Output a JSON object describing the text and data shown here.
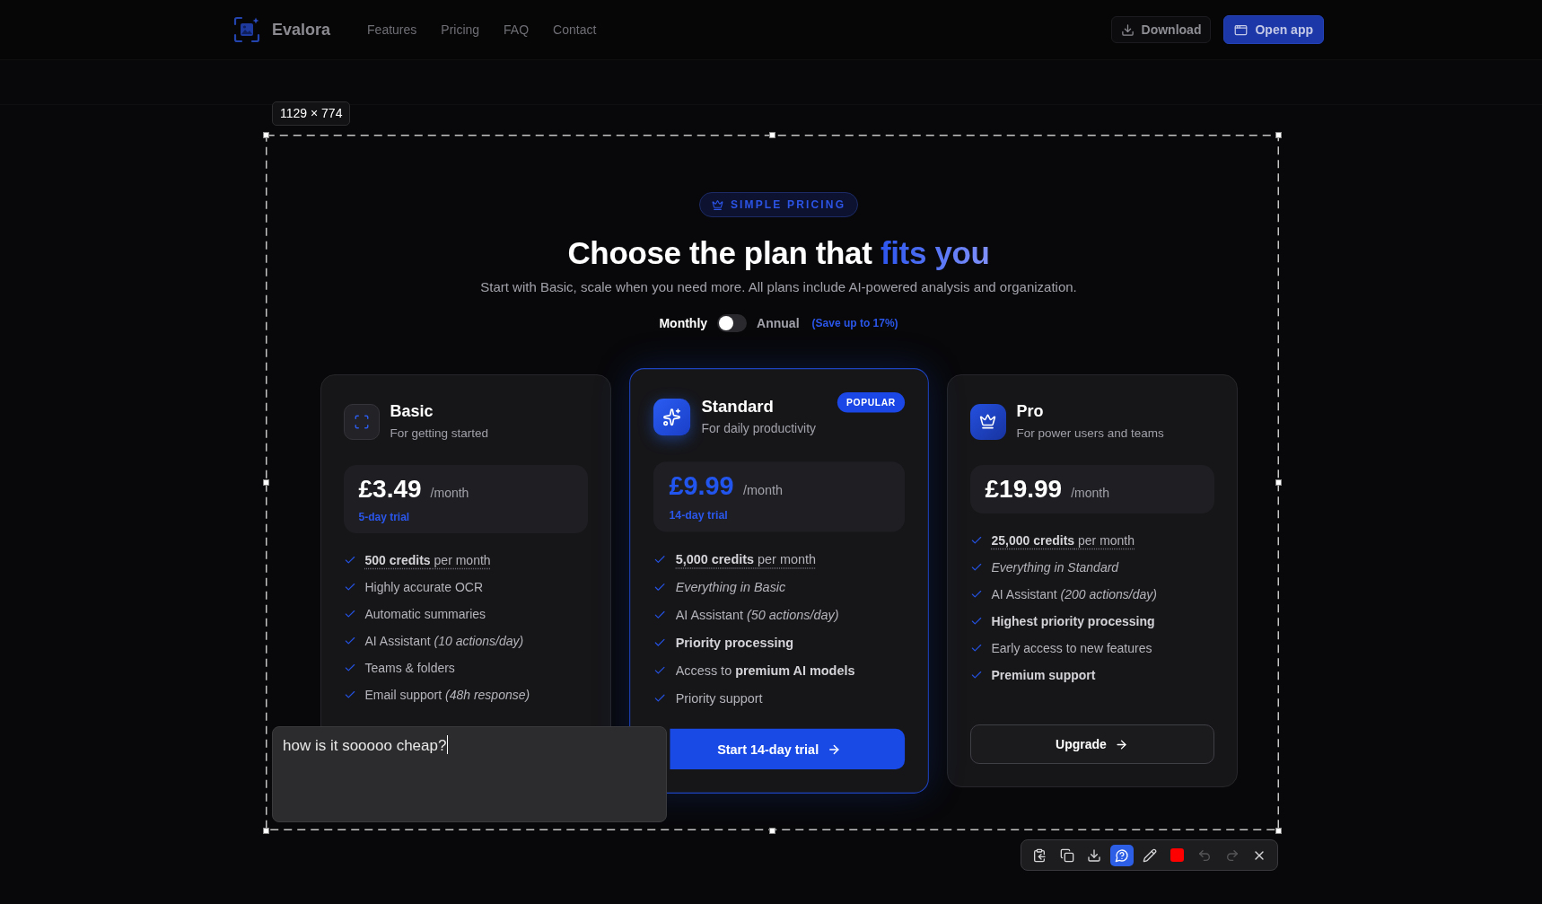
{
  "nav": {
    "brand": "Evalora",
    "links": [
      "Features",
      "Pricing",
      "FAQ",
      "Contact"
    ],
    "actions": [
      {
        "kind": "outline",
        "label": "Download"
      },
      {
        "kind": "primary",
        "label": "Open app"
      }
    ]
  },
  "pricing": {
    "badge": "SIMPLE PRICING",
    "heading": "Choose the plan that",
    "heading_highlight": "fits you",
    "subtitle": "Start with Basic, scale when you need more. All plans include AI-powered analysis and organization.",
    "billing": {
      "options": [
        {
          "label": "Monthly",
          "selected": true
        },
        {
          "label": "Annual",
          "selected": false
        }
      ],
      "toggle_on": false,
      "save_note": "(Save up to 17%)"
    },
    "plans": [
      {
        "kind": "basic",
        "name": "Basic",
        "tagline": "For getting started",
        "featured": false,
        "price": "£3.49",
        "period": "/month",
        "trial": "5-day trial",
        "features": [
          {
            "kind": "credits",
            "text": "**500 credits** per month"
          },
          {
            "kind": "plain",
            "text": "Highly accurate OCR"
          },
          {
            "kind": "plain",
            "text": "Automatic summaries"
          },
          {
            "kind": "plain",
            "text": "AI Assistant *(10 actions/day)*"
          },
          {
            "kind": "plain",
            "text": "Teams & folders"
          },
          {
            "kind": "plain",
            "text": "Email support *(48h response)*"
          }
        ]
      },
      {
        "kind": "standard",
        "name": "Standard",
        "tagline": "For daily productivity",
        "badge": "POPULAR",
        "featured": true,
        "price": "£9.99",
        "period": "/month",
        "trial": "14-day trial",
        "features": [
          {
            "kind": "credits",
            "text": "**5,000 credits** per month"
          },
          {
            "kind": "italic",
            "text": "Everything in Basic"
          },
          {
            "kind": "plain",
            "text": "AI Assistant *(50 actions/day)*"
          },
          {
            "kind": "bold",
            "text": "Priority processing"
          },
          {
            "kind": "plain",
            "text": "Access to **premium AI models**"
          },
          {
            "kind": "plain",
            "text": "Priority support"
          }
        ],
        "button": "Start 14-day trial"
      },
      {
        "kind": "pro",
        "name": "Pro",
        "tagline": "For power users and teams",
        "featured": false,
        "price": "£19.99",
        "period": "/month",
        "features": [
          {
            "kind": "credits",
            "text": "**25,000 credits** per month"
          },
          {
            "kind": "italic",
            "text": "Everything in Standard"
          },
          {
            "kind": "plain",
            "text": "AI Assistant *(200 actions/day)*"
          },
          {
            "kind": "bold",
            "text": "Highest priority processing"
          },
          {
            "kind": "plain",
            "text": "Early access to new features"
          },
          {
            "kind": "bold",
            "text": "Premium support"
          }
        ],
        "button": "Upgrade"
      }
    ]
  },
  "capture": {
    "size_label": "1129 × 774",
    "annotation": {
      "value": "how is it sooooo cheap?"
    },
    "toolbar": {
      "tools": [
        {
          "kind": "clipboard",
          "selected": false,
          "disabled": false
        },
        {
          "kind": "duplicate",
          "selected": false,
          "disabled": false
        },
        {
          "kind": "download",
          "selected": false,
          "disabled": false
        },
        {
          "kind": "comment",
          "selected": true,
          "disabled": false
        },
        {
          "kind": "pencil",
          "selected": false,
          "disabled": false
        },
        {
          "kind": "color",
          "color": "#ff0000",
          "selected": false,
          "disabled": false
        },
        {
          "kind": "undo",
          "selected": false,
          "disabled": true
        },
        {
          "kind": "redo",
          "selected": false,
          "disabled": true
        },
        {
          "kind": "close",
          "selected": false,
          "disabled": false
        }
      ]
    }
  }
}
